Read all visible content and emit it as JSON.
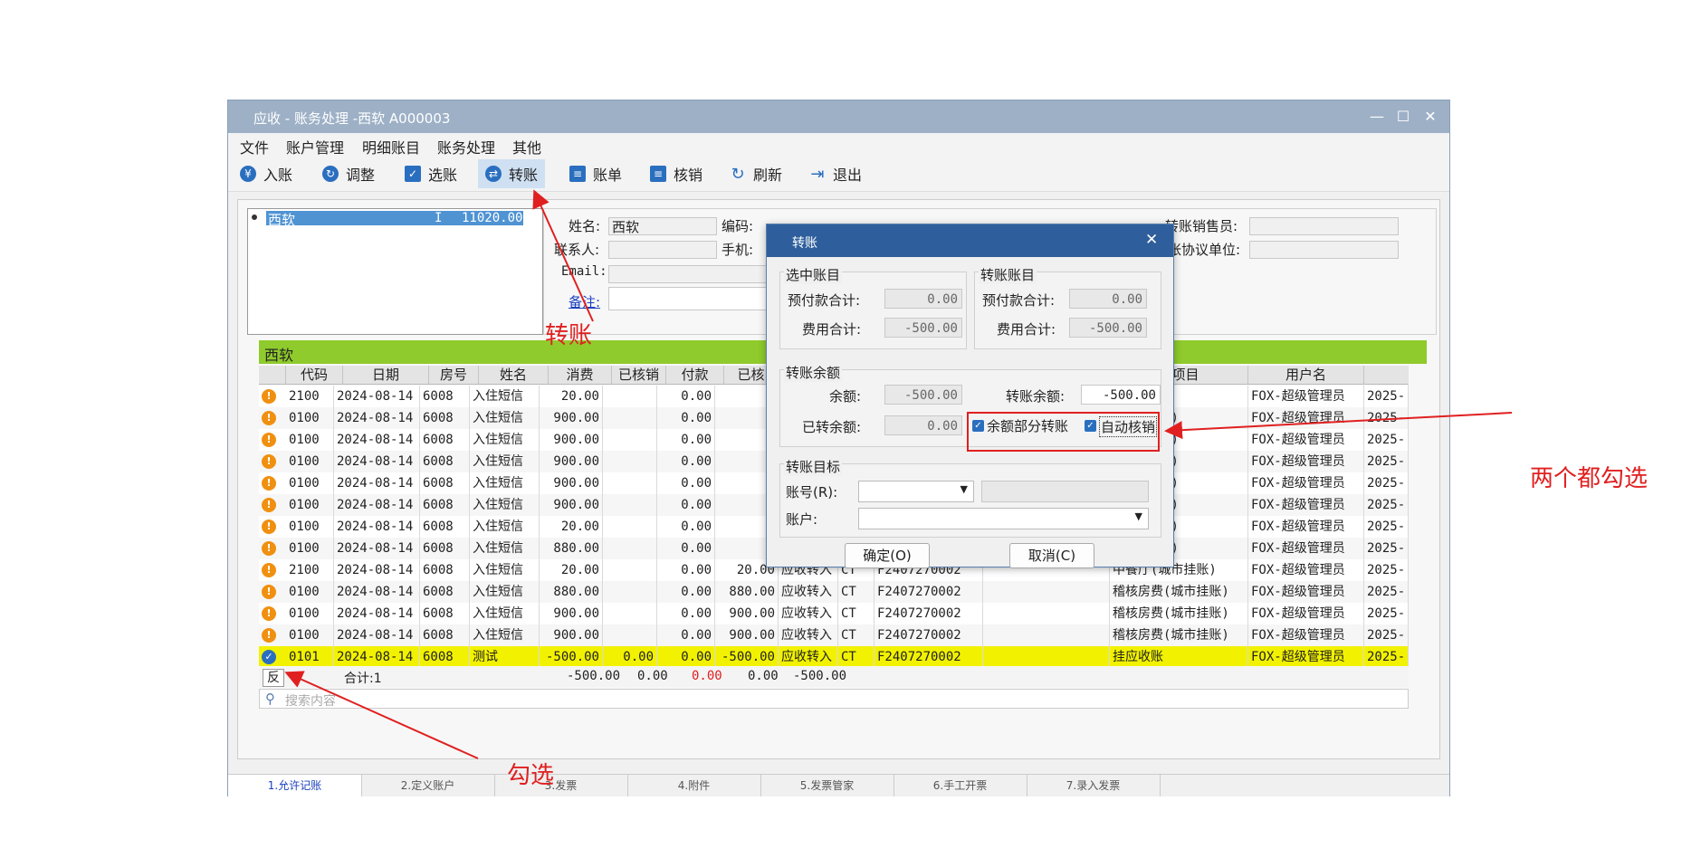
{
  "window": {
    "title": "应收 - 账务处理 -西软  A000003"
  },
  "menu": [
    "文件",
    "账户管理",
    "明细账目",
    "账务处理",
    "其他"
  ],
  "toolbar": [
    {
      "label": "入账",
      "icon": "yen-icon"
    },
    {
      "label": "调整",
      "icon": "adjust-icon"
    },
    {
      "label": "选账",
      "icon": "select-account-icon"
    },
    {
      "label": "转账",
      "icon": "transfer-icon"
    },
    {
      "label": "账单",
      "icon": "bill-icon"
    },
    {
      "label": "核销",
      "icon": "writeoff-icon"
    },
    {
      "label": "刷新",
      "icon": "refresh-icon"
    },
    {
      "label": "退出",
      "icon": "exit-icon"
    }
  ],
  "account_list": {
    "name": "西软",
    "type": "I",
    "amount": "11020.00"
  },
  "info": {
    "name_label": "姓名:",
    "name_value": "西软",
    "code_label": "编码:",
    "contact_label": "联系人:",
    "phone_label": "手机:",
    "email_label": "Email:",
    "remark_label": "备注:",
    "sales_label": "转账销售员:",
    "unit_label": "张协议单位:"
  },
  "grid": {
    "group_title": "西软",
    "headers": [
      "代码",
      "日期",
      "房号",
      "姓名",
      "消费",
      "已核销",
      "付款",
      "已核",
      "业项目",
      "用户名"
    ],
    "rows": [
      {
        "code": "2100",
        "date": "2024-08-14",
        "room": "6008",
        "name": "入住短信",
        "charge": "20.00",
        "writeoff": "",
        "pay": "0.00",
        "bal": "",
        "type": "",
        "ct": "",
        "no": "",
        "item": "城市挂账)",
        "user": "FOX-超级管理员",
        "time": "2025-",
        "status": "warn"
      },
      {
        "code": "0100",
        "date": "2024-08-14",
        "room": "6008",
        "name": "入住短信",
        "charge": "900.00",
        "writeoff": "",
        "pay": "0.00",
        "bal": "",
        "type": "",
        "ct": "",
        "no": "",
        "item": "(城市挂账)",
        "user": "FOX-超级管理员",
        "time": "2025-",
        "status": "warn"
      },
      {
        "code": "0100",
        "date": "2024-08-14",
        "room": "6008",
        "name": "入住短信",
        "charge": "900.00",
        "writeoff": "",
        "pay": "0.00",
        "bal": "",
        "type": "",
        "ct": "",
        "no": "",
        "item": "(城市挂账)",
        "user": "FOX-超级管理员",
        "time": "2025-",
        "status": "warn"
      },
      {
        "code": "0100",
        "date": "2024-08-14",
        "room": "6008",
        "name": "入住短信",
        "charge": "900.00",
        "writeoff": "",
        "pay": "0.00",
        "bal": "",
        "type": "",
        "ct": "",
        "no": "",
        "item": "(城市挂账)",
        "user": "FOX-超级管理员",
        "time": "2025-",
        "status": "warn"
      },
      {
        "code": "0100",
        "date": "2024-08-14",
        "room": "6008",
        "name": "入住短信",
        "charge": "900.00",
        "writeoff": "",
        "pay": "0.00",
        "bal": "",
        "type": "",
        "ct": "",
        "no": "",
        "item": "(城市挂账)",
        "user": "FOX-超级管理员",
        "time": "2025-",
        "status": "warn"
      },
      {
        "code": "0100",
        "date": "2024-08-14",
        "room": "6008",
        "name": "入住短信",
        "charge": "900.00",
        "writeoff": "",
        "pay": "0.00",
        "bal": "",
        "type": "",
        "ct": "",
        "no": "",
        "item": "(城市挂账)",
        "user": "FOX-超级管理员",
        "time": "2025-",
        "status": "warn"
      },
      {
        "code": "0100",
        "date": "2024-08-14",
        "room": "6008",
        "name": "入住短信",
        "charge": "20.00",
        "writeoff": "",
        "pay": "0.00",
        "bal": "",
        "type": "",
        "ct": "",
        "no": "",
        "item": "(城市挂账)",
        "user": "FOX-超级管理员",
        "time": "2025-",
        "status": "warn"
      },
      {
        "code": "0100",
        "date": "2024-08-14",
        "room": "6008",
        "name": "入住短信",
        "charge": "880.00",
        "writeoff": "",
        "pay": "0.00",
        "bal": "",
        "type": "",
        "ct": "",
        "no": "",
        "item": "(城市挂账)",
        "user": "FOX-超级管理员",
        "time": "2025-",
        "status": "warn"
      },
      {
        "code": "2100",
        "date": "2024-08-14",
        "room": "6008",
        "name": "入住短信",
        "charge": "20.00",
        "writeoff": "",
        "pay": "0.00",
        "bal": "20.00",
        "type": "应收转入",
        "ct": "CT",
        "no": "F2407270002",
        "item": "中餐厅(城市挂账)",
        "user": "FOX-超级管理员",
        "time": "2025-",
        "status": "warn"
      },
      {
        "code": "0100",
        "date": "2024-08-14",
        "room": "6008",
        "name": "入住短信",
        "charge": "880.00",
        "writeoff": "",
        "pay": "0.00",
        "bal": "880.00",
        "type": "应收转入",
        "ct": "CT",
        "no": "F2407270002",
        "item": "稽核房费(城市挂账)",
        "user": "FOX-超级管理员",
        "time": "2025-",
        "status": "warn"
      },
      {
        "code": "0100",
        "date": "2024-08-14",
        "room": "6008",
        "name": "入住短信",
        "charge": "900.00",
        "writeoff": "",
        "pay": "0.00",
        "bal": "900.00",
        "type": "应收转入",
        "ct": "CT",
        "no": "F2407270002",
        "item": "稽核房费(城市挂账)",
        "user": "FOX-超级管理员",
        "time": "2025-",
        "status": "warn"
      },
      {
        "code": "0100",
        "date": "2024-08-14",
        "room": "6008",
        "name": "入住短信",
        "charge": "900.00",
        "writeoff": "",
        "pay": "0.00",
        "bal": "900.00",
        "type": "应收转入",
        "ct": "CT",
        "no": "F2407270002",
        "item": "稽核房费(城市挂账)",
        "user": "FOX-超级管理员",
        "time": "2025-",
        "status": "warn"
      },
      {
        "code": "0101",
        "date": "2024-08-14",
        "room": "6008",
        "name": "测试",
        "charge": "-500.00",
        "writeoff": "0.00",
        "pay": "0.00",
        "bal": "-500.00",
        "type": "应收转入",
        "ct": "CT",
        "no": "F2407270002",
        "item": "挂应收账",
        "user": "FOX-超级管理员",
        "time": "2025-",
        "status": "ok"
      }
    ],
    "footer": {
      "invert": "反",
      "total_label": "合计:1",
      "charge": "-500.00",
      "writeoff": "0.00",
      "pay": "0.00",
      "bal1": "0.00",
      "bal2": "-500.00"
    },
    "search_placeholder": "搜索内容"
  },
  "dialog": {
    "title": "转账",
    "selected_group": "选中账目",
    "target_group_title": "转账账目",
    "prepay_label": "预付款合计:",
    "fee_label": "费用合计:",
    "sel_prepay": "0.00",
    "sel_fee": "-500.00",
    "tgt_prepay": "0.00",
    "tgt_fee": "-500.00",
    "balance_group": "转账余额",
    "balance_label": "余额:",
    "balance_value": "-500.00",
    "transfer_balance_label": "转账余额:",
    "transfer_balance_value": "-500.00",
    "transferred_label": "已转余额:",
    "transferred_value": "0.00",
    "partial_label": "余额部分转账",
    "auto_writeoff_label": "自动核销",
    "target_group": "转账目标",
    "account_no_label": "账号(R):",
    "account_label": "账户:",
    "ok_label": "确定(O)",
    "cancel_label": "取消(C)"
  },
  "tabs": [
    "1.允许记账",
    "2.定义账户",
    "3.发票",
    "4.附件",
    "5.发票管家",
    "6.手工开票",
    "7.录入发票"
  ],
  "annotations": {
    "transfer": "转账",
    "check_both": "两个都勾选",
    "check": "勾选"
  }
}
